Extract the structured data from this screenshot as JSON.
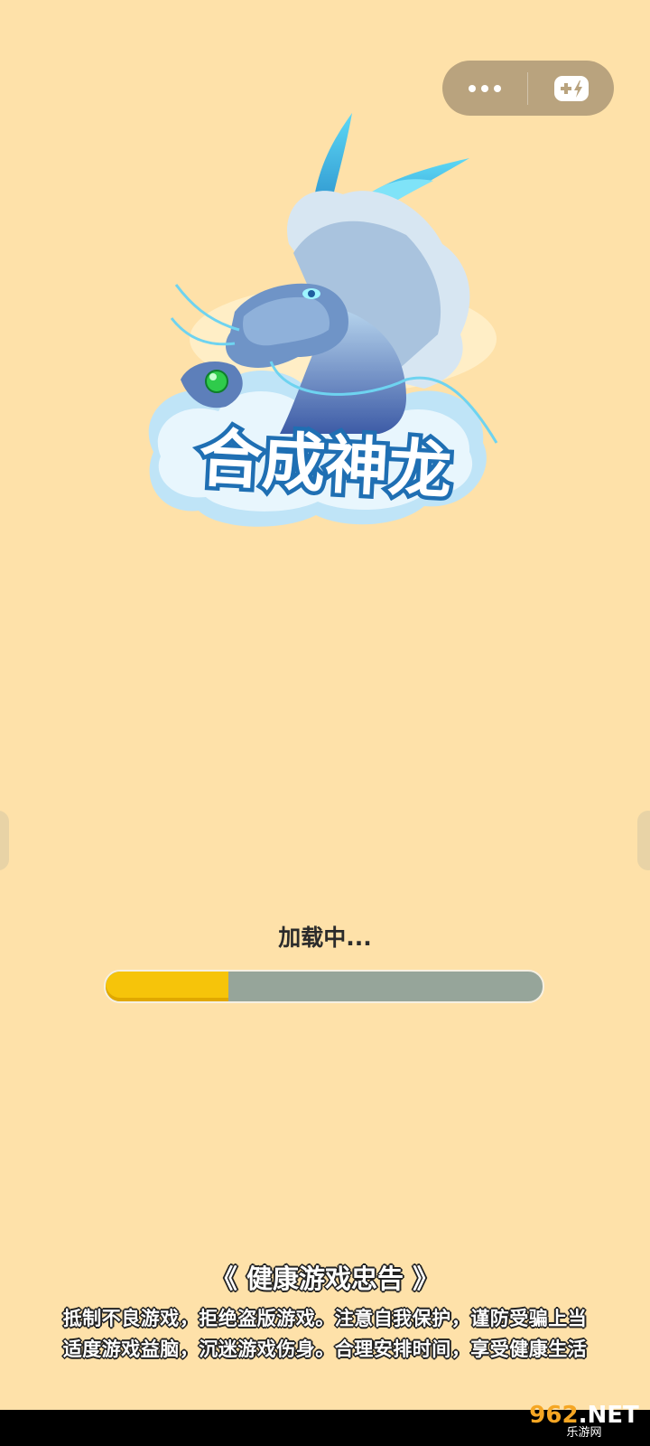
{
  "capsule": {
    "more_icon": "more-dots-icon",
    "game_icon": "gamepad-icon"
  },
  "logo": {
    "title": "合成神龙",
    "icon": "dragon-icon"
  },
  "loading": {
    "label": "加载中...",
    "progress": 0.28
  },
  "notice": {
    "title": "《 健康游戏忠告 》",
    "line1": "抵制不良游戏，拒绝盗版游戏。注意自我保护，谨防受骗上当",
    "line2": "适度游戏益脑，沉迷游戏伤身。合理安排时间，享受健康生活"
  },
  "watermark": {
    "main_a": "962",
    "main_b": ".NET",
    "sub": "乐游网"
  }
}
